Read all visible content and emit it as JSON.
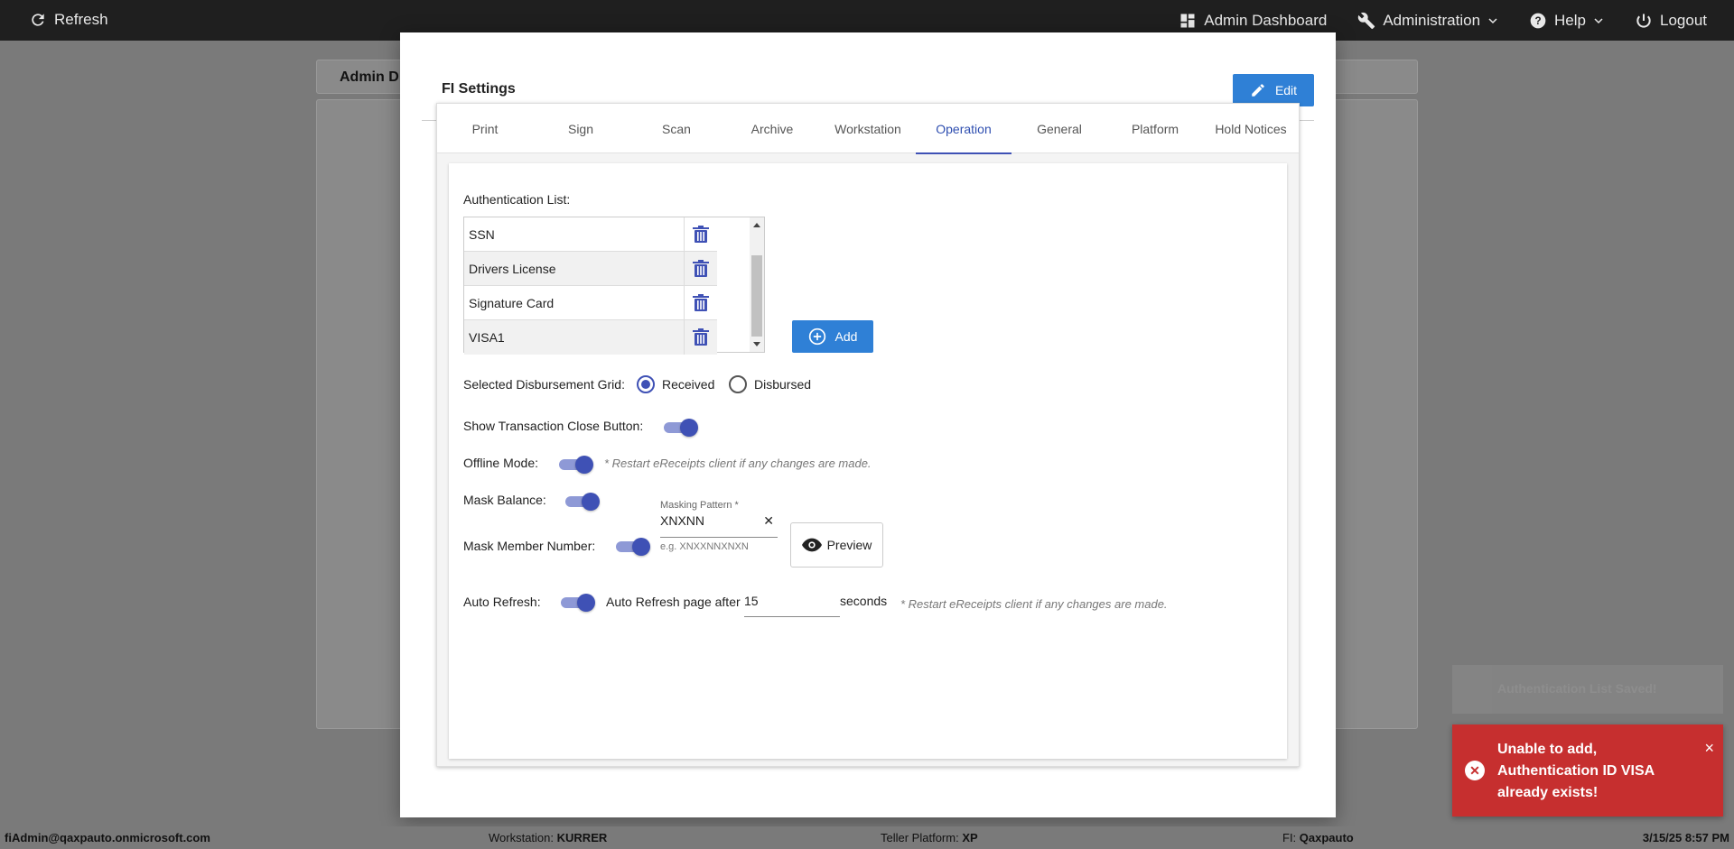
{
  "topbar": {
    "refresh": "Refresh",
    "admin_dashboard": "Admin Dashboard",
    "administration": "Administration",
    "help": "Help",
    "logout": "Logout"
  },
  "background": {
    "title": "Admin D"
  },
  "modal": {
    "title": "FI Settings",
    "edit_label": "Edit",
    "tabs": [
      "Print",
      "Sign",
      "Scan",
      "Archive",
      "Workstation",
      "Operation",
      "General",
      "Platform",
      "Hold Notices"
    ],
    "active_tab": "Operation"
  },
  "operation": {
    "auth_list_label": "Authentication List:",
    "auth_items": [
      "SSN",
      "Drivers License",
      "Signature Card",
      "VISA1"
    ],
    "add_label": "Add",
    "disbursement_label": "Selected Disbursement Grid:",
    "disbursement_options": [
      "Received",
      "Disbursed"
    ],
    "disbursement_selected": "Received",
    "show_close_label": "Show Transaction Close Button:",
    "offline_label": "Offline Mode:",
    "restart_note": "* Restart eReceipts client if any changes are made.",
    "mask_balance_label": "Mask Balance:",
    "mask_member_label": "Mask Member Number:",
    "masking_pattern_label": "Masking Pattern *",
    "masking_pattern_value": "XNXNN",
    "masking_hint": "e.g. XNXXNNXNXN",
    "preview_label": "Preview",
    "auto_refresh_label": "Auto Refresh:",
    "auto_refresh_after": "Auto Refresh page after",
    "auto_refresh_value": "15",
    "seconds": "seconds",
    "toggles": {
      "show_close": true,
      "offline": true,
      "mask_balance": true,
      "mask_member": true,
      "auto_refresh": true
    }
  },
  "statusbar": {
    "user": "fiAdmin@qaxpauto.onmicrosoft.com",
    "workstation_label": "Workstation:",
    "workstation": "KURRER",
    "teller_label": "Teller Platform:",
    "teller": "XP",
    "fi_label": "FI:",
    "fi": "Qaxpauto",
    "datetime": "3/15/25 8:57 PM"
  },
  "toasts": {
    "ghost": "Authentication List Saved!",
    "error": "Unable to add, Authentication ID VISA already exists!",
    "close": "×"
  },
  "colors": {
    "primary": "#2f80d6",
    "accent": "#3f51b5",
    "error": "#c62f2f",
    "topbar": "#1f1f1f"
  }
}
